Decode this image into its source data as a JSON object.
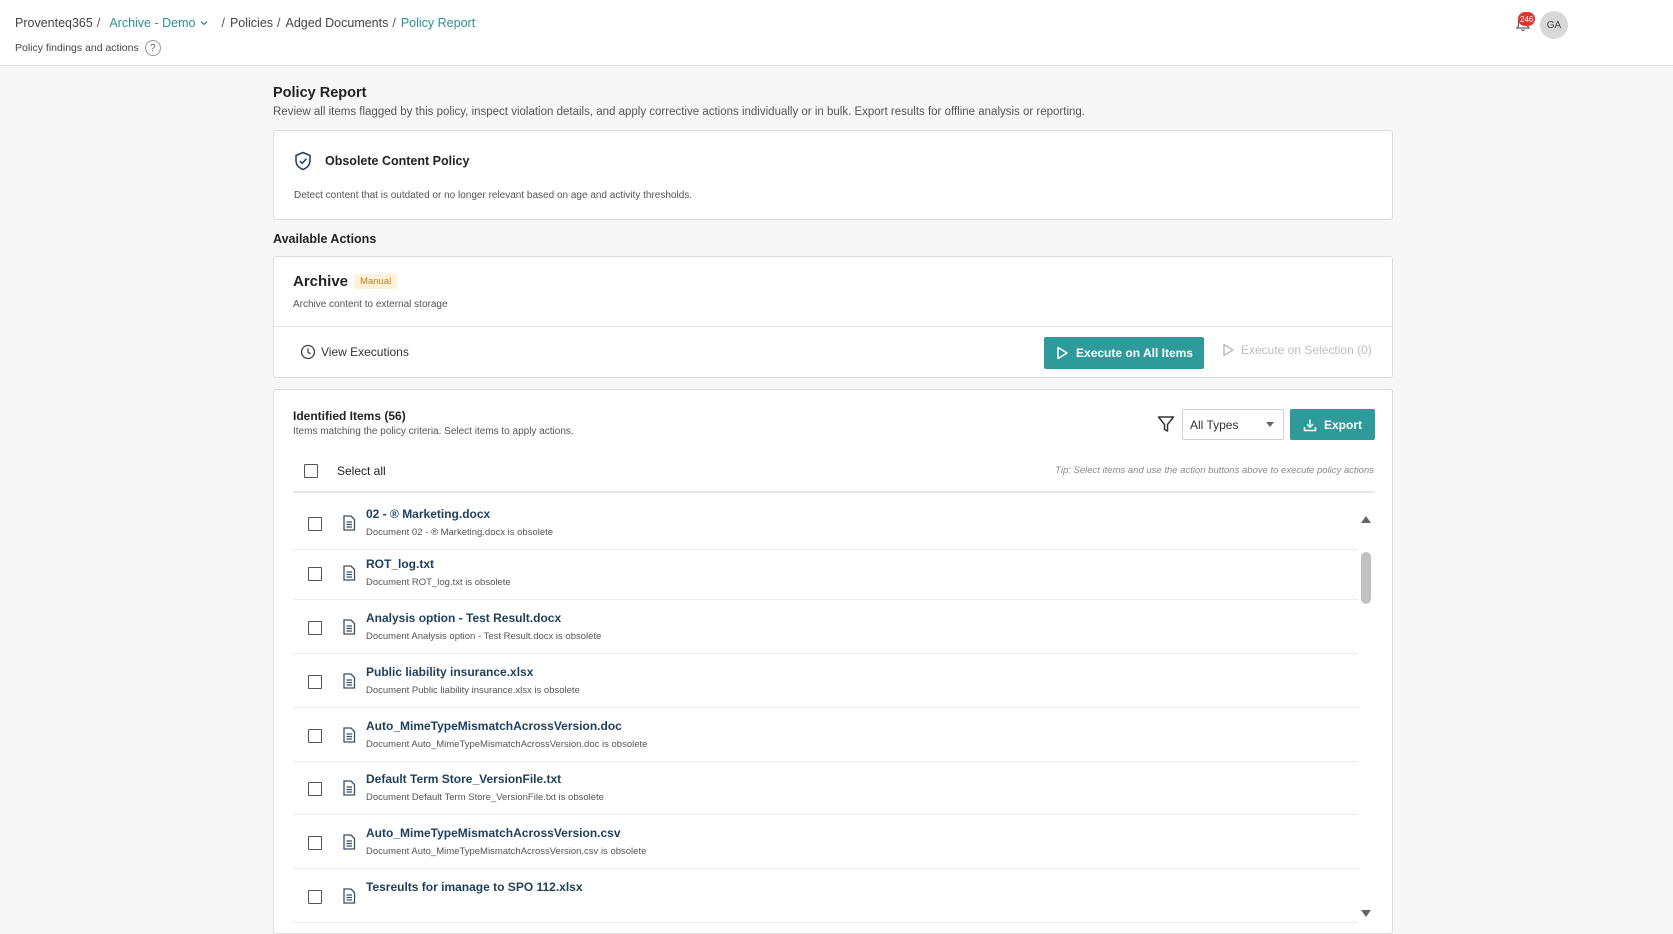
{
  "breadcrumb": {
    "app": "Proventeq365",
    "tenant": "Archive - Demo",
    "policies": "Policies",
    "aged": "Adged Documents",
    "current": "Policy Report"
  },
  "header": {
    "subtitle": "Policy findings and actions",
    "help_glyph": "?",
    "notification_count": "246",
    "avatar_initials": "GA"
  },
  "page": {
    "title": "Policy Report",
    "description": "Review all items flagged by this policy, inspect violation details, and apply corrective actions individually or in bulk. Export results for offline analysis or reporting."
  },
  "policy": {
    "name": "Obsolete Content Policy",
    "description": "Detect content that is outdated or no longer relevant based on age and activity thresholds."
  },
  "actions": {
    "heading": "Available Actions",
    "name": "Archive",
    "badge": "Manual",
    "description": "Archive content to external storage",
    "view_executions": "View Executions",
    "execute_all": "Execute on All Items",
    "execute_selection": "Execute on Selection (0)"
  },
  "items": {
    "title": "Identified Items (56)",
    "subtitle": "Items matching the policy criteria. Select items to apply actions.",
    "filter_value": "All Types",
    "export": "Export",
    "select_all": "Select all",
    "tip": "Tip: Select items and use the action buttons above to execute policy actions",
    "rows": [
      {
        "name": "02 - ® Marketing.docx",
        "desc": "Document 02 - ® Marketing.docx is obsolete"
      },
      {
        "name": "ROT_log.txt",
        "desc": "Document ROT_log.txt is obsolete"
      },
      {
        "name": "Analysis option - Test Result.docx",
        "desc": "Document Analysis option - Test Result.docx is obsolete"
      },
      {
        "name": "Public liability insurance.xlsx",
        "desc": "Document Public liability insurance.xlsx is obsolete"
      },
      {
        "name": "Auto_MimeTypeMismatchAcrossVersion.doc",
        "desc": "Document Auto_MimeTypeMismatchAcrossVersion.doc is obsolete"
      },
      {
        "name": "Default Term Store_VersionFile.txt",
        "desc": "Document Default Term Store_VersionFile.txt is obsolete"
      },
      {
        "name": "Auto_MimeTypeMismatchAcrossVersion.csv",
        "desc": "Document Auto_MimeTypeMismatchAcrossVersion.csv is obsolete"
      },
      {
        "name": "Tesreults for imanage to SPO 112.xlsx",
        "desc": ""
      }
    ]
  },
  "icons": {
    "chevron": "chevron-down-icon",
    "bell": "bell-icon",
    "shield": "shield-check-icon",
    "clock": "clock-icon",
    "play": "play-icon",
    "filter": "filter-icon",
    "download": "download-icon",
    "document": "document-icon"
  },
  "colors": {
    "accent": "#2e9a9a",
    "link": "#2e8f95",
    "manual_badge_bg": "#fdf1d8",
    "manual_badge_text": "#b9801e",
    "notification": "#e2342f"
  }
}
